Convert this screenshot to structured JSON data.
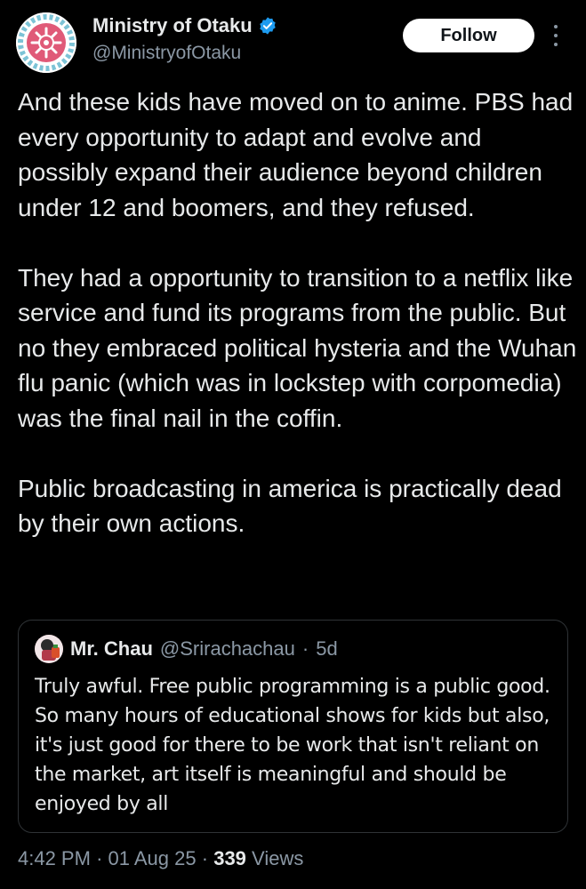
{
  "author": {
    "display_name": "Ministry of Otaku",
    "handle": "@MinistryofOtaku",
    "verified": true,
    "avatar_icon": "ministry-of-otaku-logo"
  },
  "actions": {
    "follow_label": "Follow",
    "more_icon": "more-vertical-icon"
  },
  "tweet": {
    "paragraphs": [
      "And these kids have moved on to anime. PBS had every opportunity to adapt and evolve and possibly expand their audience beyond children under 12 and boomers, and they refused.",
      "They had a opportunity to transition to a netflix like service and fund its programs from the public. But no they embraced political hysteria and the Wuhan flu panic (which was in lockstep with corpomedia) was the final nail in the coffin.",
      "Public broadcasting in america is practically dead by their own actions."
    ]
  },
  "quoted_tweet": {
    "display_name": "Mr. Chau",
    "handle": "@Srirachachau",
    "separator": "·",
    "time_ago": "5d",
    "text": "Truly awful. Free public programming is a public good. So many hours of educational shows for kids but also, it's just good for there to be work that isn't reliant on the market, art itself is meaningful and should be enjoyed by all"
  },
  "meta": {
    "time": "4:42 PM",
    "separator": "·",
    "date": "01 Aug 25",
    "views_count": "339",
    "views_label": "Views"
  },
  "colors": {
    "background": "#000000",
    "text_primary": "#e7e9ea",
    "text_secondary": "#8b98a5",
    "verified_blue": "#1d9bf0",
    "border": "#2f3336"
  }
}
